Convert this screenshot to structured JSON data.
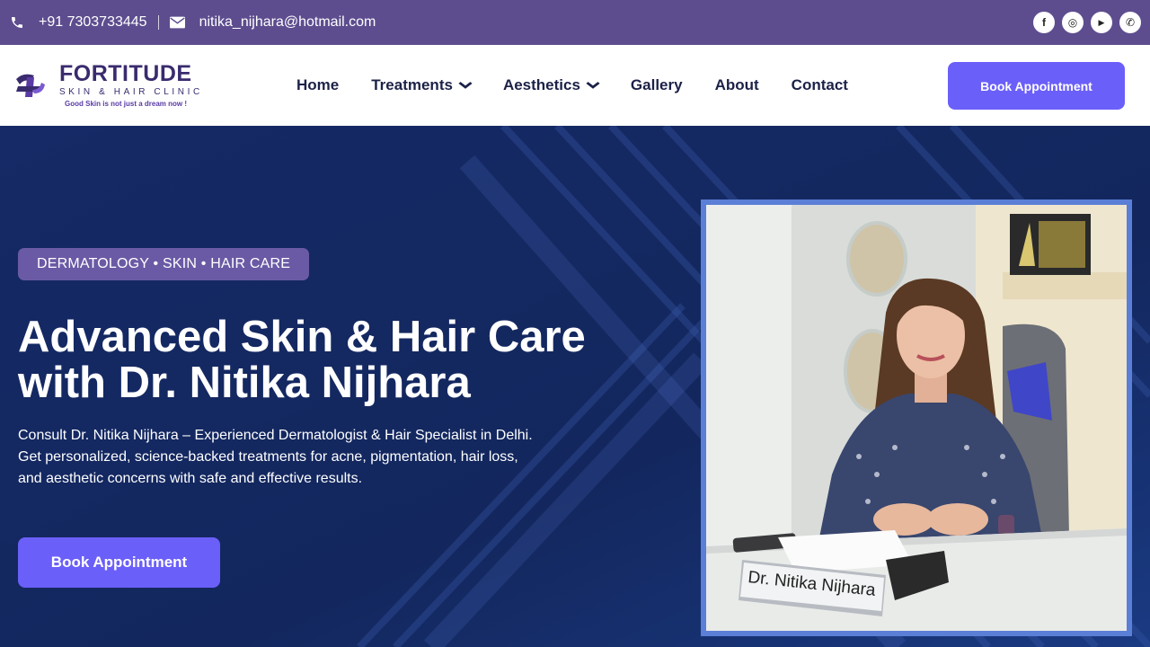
{
  "topbar": {
    "phone": "+91 7303733445",
    "email": "nitika_nijhara@hotmail.com",
    "social": [
      {
        "icon": "facebook-icon",
        "glyph": "f"
      },
      {
        "icon": "instagram-icon",
        "glyph": "◎"
      },
      {
        "icon": "youtube-icon",
        "glyph": "▶"
      },
      {
        "icon": "whatsapp-icon",
        "glyph": "✆"
      }
    ]
  },
  "logo": {
    "brand": "FORTITUDE",
    "sub": "SKIN & HAIR CLINIC",
    "tagline": "Good Skin is not just a dream now !"
  },
  "nav": {
    "items": [
      "Home",
      "Treatments",
      "Aesthetics",
      "Gallery",
      "About",
      "Contact"
    ],
    "dropdown_chevron": "⌄",
    "book_label": "Book Appointment"
  },
  "hero": {
    "badge": "DERMATOLOGY • SKIN • HAIR CARE",
    "headline_line1": "Advanced Skin & Hair Care",
    "headline_line2": "with Dr. Nitika Nijhara",
    "desc_line1": "Consult Dr. Nitika Nijhara – Experienced Dermatologist & Hair Specialist in Delhi.",
    "desc_line2": "Get personalized, science-backed treatments for acne, pigmentation, hair loss,",
    "desc_line3": "and aesthetic concerns with safe and effective results.",
    "book_label": "Book Appointment",
    "nameplate": "Dr. Nitika Nijhara"
  },
  "colors": {
    "topbar": "#5d4d8f",
    "accent": "#6b5ff9",
    "hero_bg": "#13275e",
    "badge": "#6a5aa5",
    "frame": "#5b7fd6",
    "nav_text": "#1c2147"
  }
}
